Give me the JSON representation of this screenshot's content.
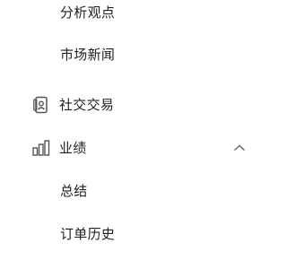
{
  "menu": {
    "items": [
      {
        "label": "分析观点"
      },
      {
        "label": "市场新闻"
      },
      {
        "label": "社交交易",
        "icon": "social-trading-icon"
      },
      {
        "label": "业绩",
        "icon": "bar-chart-icon",
        "expanded": true
      },
      {
        "label": "总结"
      },
      {
        "label": "订单历史"
      }
    ]
  },
  "colors": {
    "text": "#1f1f1f",
    "icon": "#555555",
    "background": "#ffffff"
  }
}
